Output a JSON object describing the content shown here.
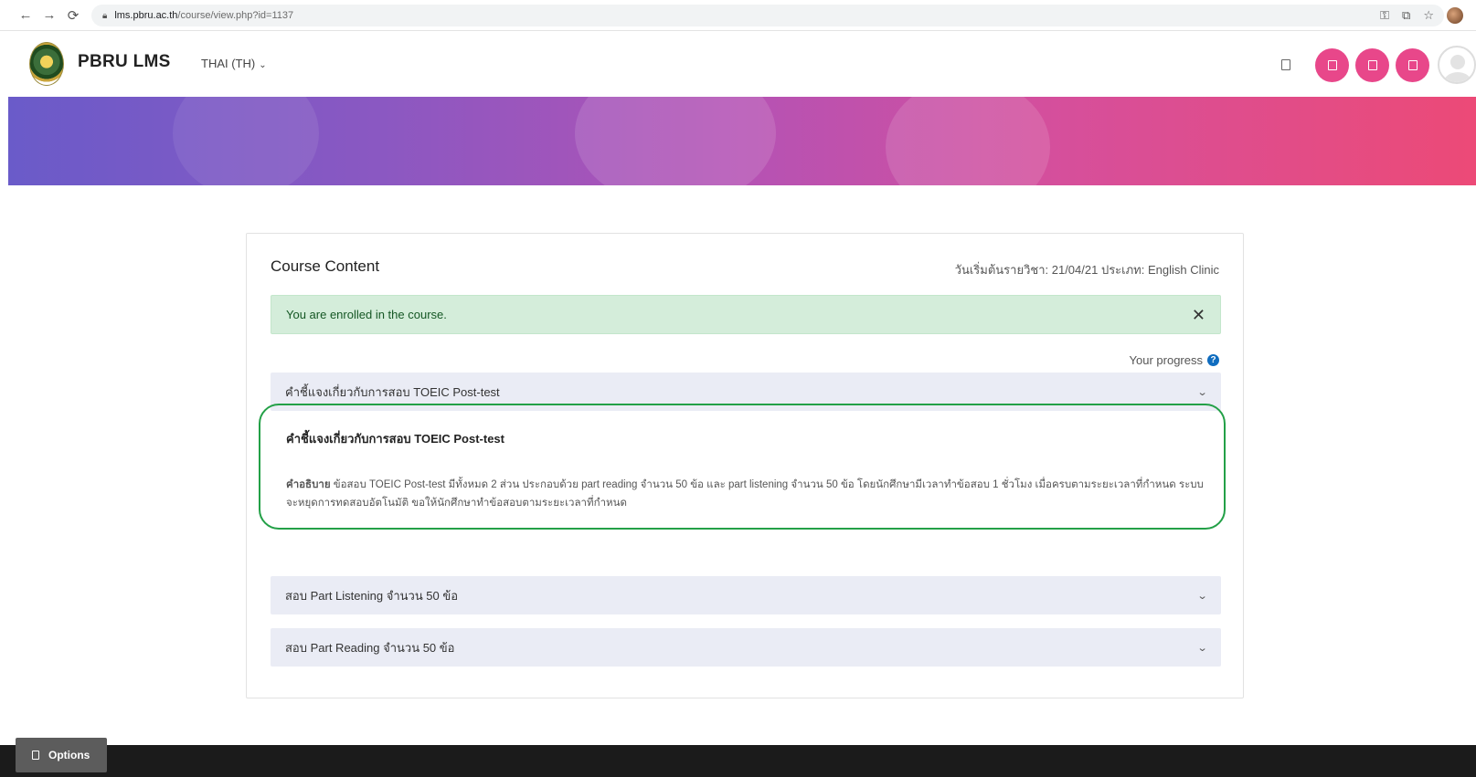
{
  "browser": {
    "url_host": "lms.pbru.ac.th",
    "url_path": "/course/view.php?id=1137"
  },
  "header": {
    "brand": "PBRU LMS",
    "language": "THAI (TH)"
  },
  "course": {
    "title": "Course Content",
    "meta": "วันเริ่มต้นรายวิชา: 21/04/21   ประเภท: English Clinic",
    "alert": "You are enrolled in the course.",
    "progress_label": "Your progress"
  },
  "sections": [
    {
      "title": "คำชี้แจงเกี่ยวกับการสอบ TOEIC Post-test"
    },
    {
      "title": "สอบ Part Listening จำนวน 50 ข้อ"
    },
    {
      "title": "สอบ Part Reading จำนวน 50 ข้อ"
    }
  ],
  "topic": {
    "heading": "คำชี้แจงเกี่ยวกับการสอบ TOEIC Post-test",
    "desc_label": "คำอธิบาย",
    "desc_text": " ข้อสอบ TOEIC Post-test มีทั้งหมด 2 ส่วน ประกอบด้วย part reading  จำนวน 50 ข้อ และ part listening จำนวน 50 ข้อ โดยนักศึกษามีเวลาทำข้อสอบ 1 ชั่วโมง เมื่อครบตามระยะเวลาที่กำหนด ระบบจะหยุดการทดสอบอัตโนมัติ ขอให้นักศึกษาทำข้อสอบตามระยะเวลาที่กำหนด"
  },
  "footer": {
    "options_label": "Options"
  }
}
